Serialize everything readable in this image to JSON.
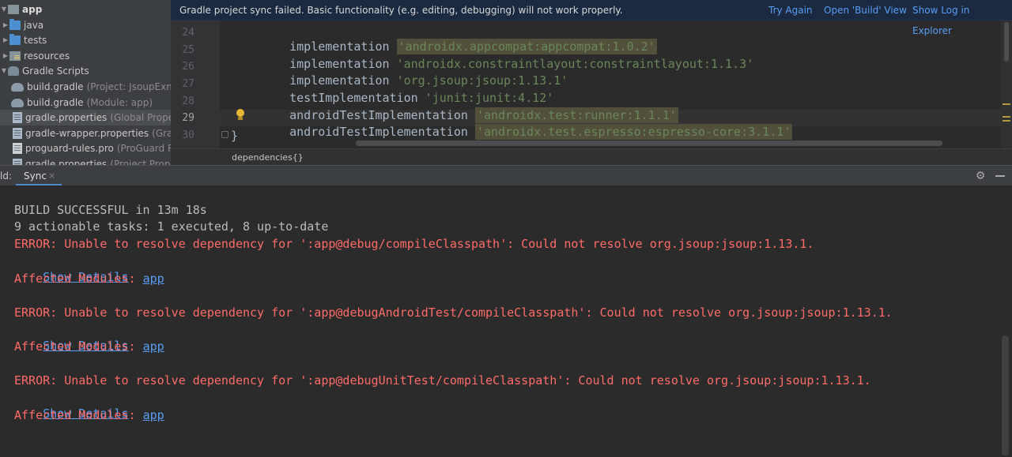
{
  "project_tree": {
    "items": [
      {
        "name": "app",
        "hint": ""
      },
      {
        "name": "java",
        "hint": ""
      },
      {
        "name": "tests",
        "hint": ""
      },
      {
        "name": "resources",
        "hint": ""
      },
      {
        "name": "Gradle Scripts",
        "hint": ""
      },
      {
        "name": "build.gradle",
        "hint": "(Project: JsoupExmpl)"
      },
      {
        "name": "build.gradle",
        "hint": "(Module: app)"
      },
      {
        "name": "gradle.properties",
        "hint": "(Global Properties)"
      },
      {
        "name": "gradle-wrapper.properties",
        "hint": "(Gradle Version)"
      },
      {
        "name": "proguard-rules.pro",
        "hint": "(ProGuard Rules for app)"
      },
      {
        "name": "gradle.properties",
        "hint": "(Project Properties)"
      }
    ]
  },
  "banner": {
    "message": "Gradle project sync failed. Basic functionality (e.g. editing, debugging) will not work properly.",
    "try_again": "Try Again",
    "open_build": "Open 'Build' View",
    "show_log": "Show Log in Explorer"
  },
  "editor": {
    "lines": [
      {
        "num": "24",
        "kw": "implementation",
        "str": "'androidx.appcompat:appcompat:1.0.2'",
        "hl": true
      },
      {
        "num": "25",
        "kw": "implementation",
        "str": "'androidx.constraintlayout:constraintlayout:1.1.3'",
        "hl": false
      },
      {
        "num": "26",
        "kw": "implementation",
        "str": "'org.jsoup:jsoup:1.13.1'",
        "hl": false
      },
      {
        "num": "27",
        "kw": "testImplementation",
        "str": "'junit:junit:4.12'",
        "hl": false
      },
      {
        "num": "28",
        "kw": "androidTestImplementation",
        "str": "'androidx.test:runner:1.1.1'",
        "hl": true
      },
      {
        "num": "29",
        "kw": "androidTestImplementation",
        "str": "'androidx.test.espresso:espresso-core:3.1.1'",
        "hl": true
      },
      {
        "num": "30",
        "kw": "",
        "str": "",
        "hl": false
      }
    ],
    "closing_brace": "}"
  },
  "breadcrumb": "dependencies{}",
  "build_panel": {
    "prefix": "ld:",
    "tab_label": "Sync",
    "tab_close": "×",
    "lines": {
      "l1": "BUILD SUCCESSFUL in 13m 18s",
      "l2": "9 actionable tasks: 1 executed, 8 up-to-date",
      "e1": "ERROR: Unable to resolve dependency for ':app@debug/compileClasspath': Could not resolve org.jsoup:jsoup:1.13.1.",
      "e2": "ERROR: Unable to resolve dependency for ':app@debugAndroidTest/compileClasspath': Could not resolve org.jsoup:jsoup:1.13.1.",
      "e3": "ERROR: Unable to resolve dependency for ':app@debugUnitTest/compileClasspath': Could not resolve org.jsoup:jsoup:1.13.1."
    },
    "show_details": "Show Details",
    "affected_label": "Affected Modules: ",
    "affected_module": "app"
  },
  "colors": {
    "background": "#2b2b2b",
    "error": "#ff6b68",
    "link": "#589df6",
    "string": "#6a8759",
    "banner": "#1b2a40"
  }
}
